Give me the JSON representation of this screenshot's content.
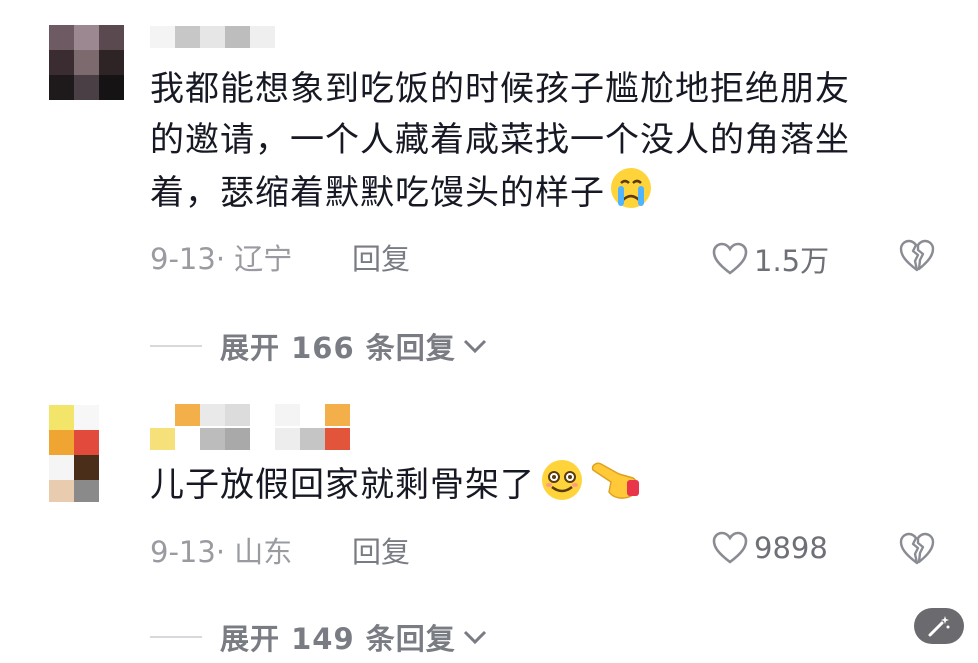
{
  "comments": [
    {
      "text_lines": [
        "我都能想象到吃饭的时候孩子尴尬地拒绝朋友",
        "的邀请，一个人藏着咸菜找一个没人的角落坐",
        "着，瑟缩着默默吃馒头的样子"
      ],
      "emoji_trailing": "crying-face-emoji",
      "date": "9-13",
      "location": "辽宁",
      "reply_label": "回复",
      "likes": "1.5万",
      "expand_label": "展开 166 条回复"
    },
    {
      "text_lines": [
        "儿子放假回家就剩骨架了"
      ],
      "emoji_trailing": "smiling-face-emoji, pointing-hand-emoji",
      "date": "9-13",
      "location": "山东",
      "reply_label": "回复",
      "likes": "9898",
      "expand_label": "展开 149 条回复"
    }
  ],
  "colors": {
    "text": "#161823",
    "meta": "#9a9ba1",
    "secondary": "#7a7c84"
  },
  "icons": [
    "heart-outline-icon",
    "broken-heart-icon",
    "chevron-down-icon",
    "magic-wand-icon"
  ]
}
